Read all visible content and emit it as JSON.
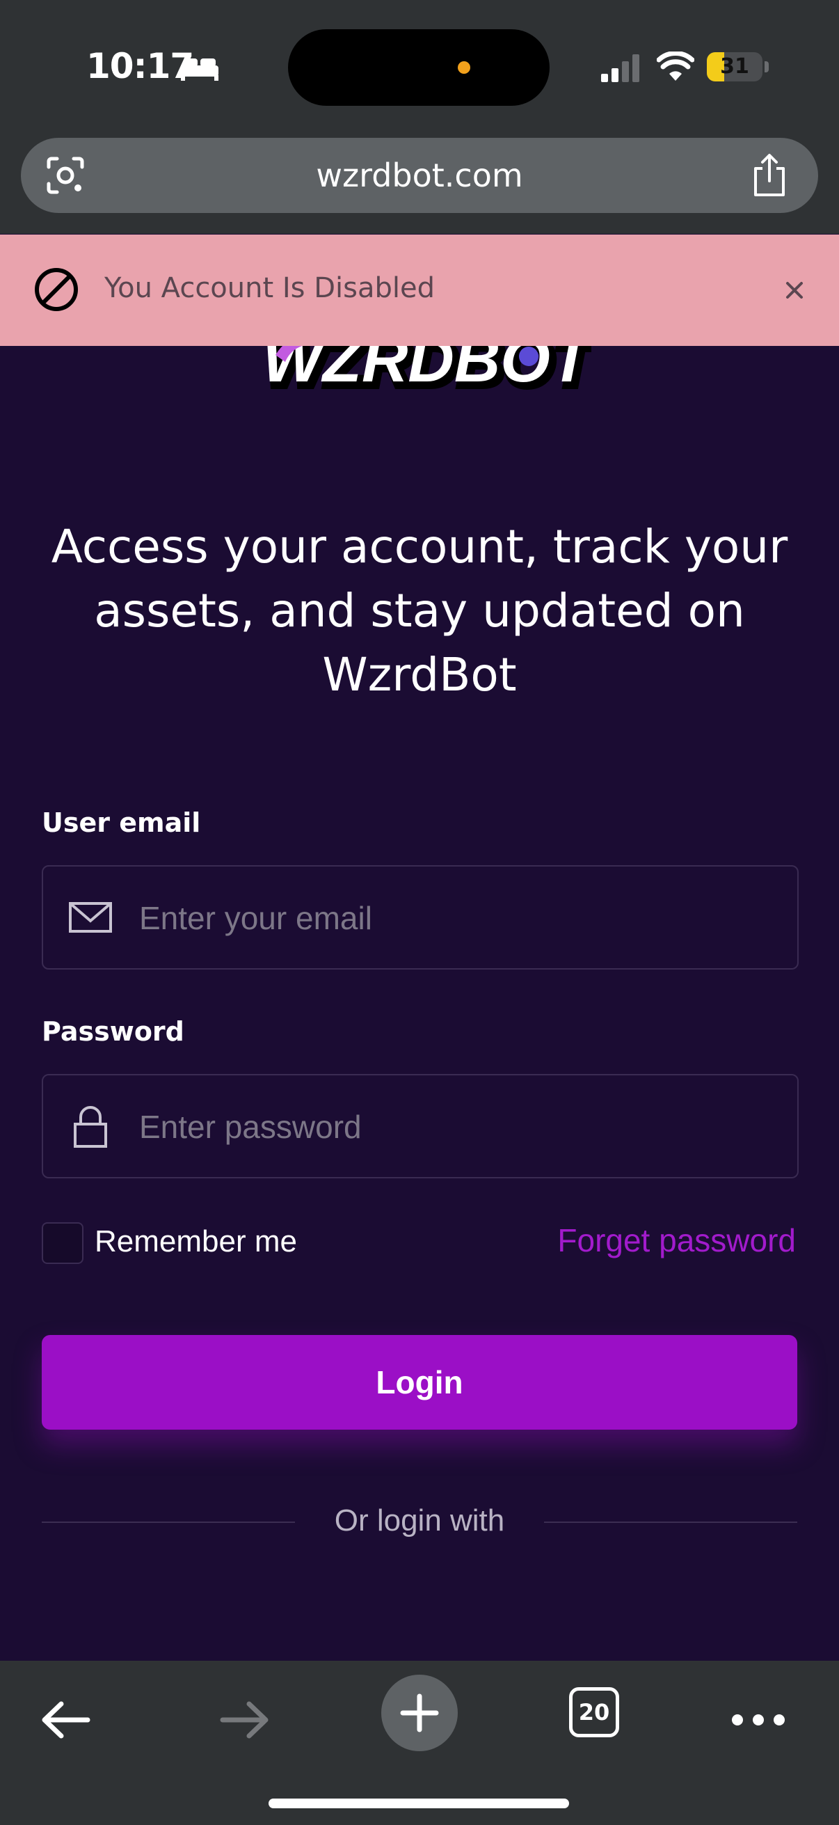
{
  "status_bar": {
    "time": "10:17",
    "battery_level": "31",
    "battery_fraction": 0.31,
    "icons": [
      "bed-icon",
      "signal-icon",
      "wifi-icon",
      "battery-icon"
    ]
  },
  "browser": {
    "url": "wzrdbot.com",
    "icons": [
      "lens-icon",
      "share-icon"
    ]
  },
  "alert": {
    "message": "You Account Is Disabled",
    "icons": [
      "blocked-icon",
      "close-icon"
    ],
    "background": "#e9a3ad"
  },
  "logo": {
    "text": "WZRDBOT"
  },
  "headline": "Access your account, track your assets, and stay updated on WzrdBot",
  "form": {
    "email_label": "User email",
    "email_placeholder": "Enter your email",
    "password_label": "Password",
    "password_placeholder": "Enter password",
    "remember_label": "Remember me",
    "forget_label": "Forget password",
    "login_label": "Login",
    "or_label": "Or login with"
  },
  "toolbar": {
    "tab_count": "20",
    "icons": [
      "back-arrow-icon",
      "forward-arrow-icon",
      "plus-icon",
      "tabs-icon",
      "more-icon"
    ]
  },
  "colors": {
    "page_background": "#1b0c33",
    "accent": "#9b0fc6",
    "link": "#a21bcc",
    "chrome": "#2f3234"
  }
}
